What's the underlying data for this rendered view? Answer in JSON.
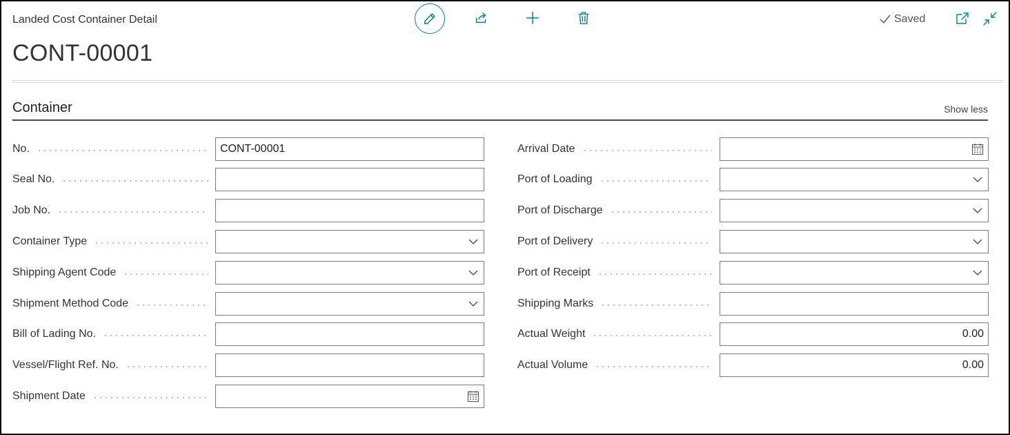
{
  "header": {
    "caption": "Landed Cost Container Detail",
    "title": "CONT-00001",
    "saved_label": "Saved"
  },
  "section": {
    "title": "Container",
    "show_less": "Show less"
  },
  "left_fields": [
    {
      "label": "No.",
      "value": "CONT-00001",
      "type": "text"
    },
    {
      "label": "Seal No.",
      "value": "",
      "type": "text"
    },
    {
      "label": "Job No.",
      "value": "",
      "type": "text"
    },
    {
      "label": "Container Type",
      "value": "",
      "type": "dropdown"
    },
    {
      "label": "Shipping Agent Code",
      "value": "",
      "type": "dropdown"
    },
    {
      "label": "Shipment Method Code",
      "value": "",
      "type": "dropdown"
    },
    {
      "label": "Bill of Lading No.",
      "value": "",
      "type": "text"
    },
    {
      "label": "Vessel/Flight Ref. No.",
      "value": "",
      "type": "text"
    },
    {
      "label": "Shipment Date",
      "value": "",
      "type": "date"
    }
  ],
  "right_fields": [
    {
      "label": "Arrival Date",
      "value": "",
      "type": "date"
    },
    {
      "label": "Port of Loading",
      "value": "",
      "type": "dropdown"
    },
    {
      "label": "Port of Discharge",
      "value": "",
      "type": "dropdown"
    },
    {
      "label": "Port of Delivery",
      "value": "",
      "type": "dropdown"
    },
    {
      "label": "Port of Receipt",
      "value": "",
      "type": "dropdown"
    },
    {
      "label": "Shipping Marks",
      "value": "",
      "type": "text"
    },
    {
      "label": "Actual Weight",
      "value": "0.00",
      "type": "number"
    },
    {
      "label": "Actual Volume",
      "value": "0.00",
      "type": "number"
    }
  ],
  "icons": {
    "edit": "pencil-icon",
    "share": "share-icon",
    "new": "plus-icon",
    "delete": "trash-icon",
    "saved": "checkmark-icon",
    "open_new": "open-in-new-window-icon",
    "collapse": "collapse-icon",
    "dropdown": "chevron-down-icon",
    "date": "calendar-icon"
  },
  "colors": {
    "accent": "#00838f",
    "section_line": "#3d4e5a"
  }
}
